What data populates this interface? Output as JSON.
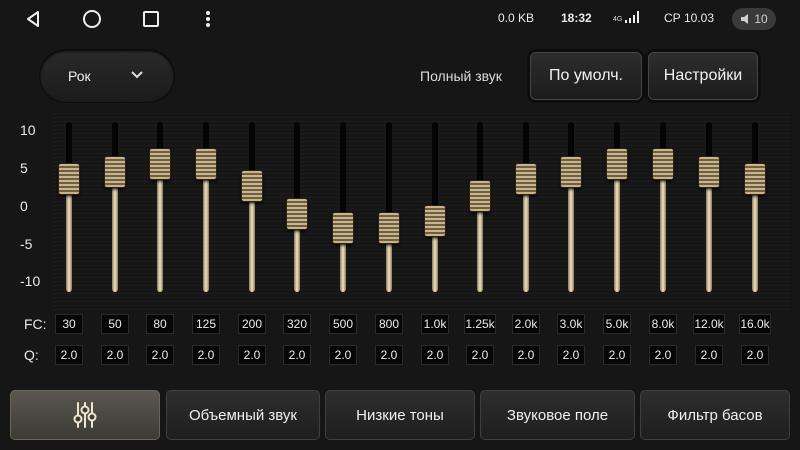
{
  "status": {
    "data_rate": "0.0 KB",
    "time": "18:32",
    "network": "4G",
    "date": "СР 10.03",
    "volume": "10"
  },
  "top": {
    "preset_value": "Рок",
    "full_sound_label": "Полный звук",
    "default_button": "По умолч.",
    "settings_button": "Настройки"
  },
  "scale": [
    "10",
    "5",
    "0",
    "-5",
    "-10"
  ],
  "fc_label": "FC:",
  "q_label": "Q:",
  "bands": [
    {
      "fc": "30",
      "q": "2.0",
      "gain": 4
    },
    {
      "fc": "50",
      "q": "2.0",
      "gain": 5
    },
    {
      "fc": "80",
      "q": "2.0",
      "gain": 6
    },
    {
      "fc": "125",
      "q": "2.0",
      "gain": 6
    },
    {
      "fc": "200",
      "q": "2.0",
      "gain": 3
    },
    {
      "fc": "320",
      "q": "2.0",
      "gain": -1
    },
    {
      "fc": "500",
      "q": "2.0",
      "gain": -3
    },
    {
      "fc": "800",
      "q": "2.0",
      "gain": -3
    },
    {
      "fc": "1.0k",
      "q": "2.0",
      "gain": -2
    },
    {
      "fc": "1.25k",
      "q": "2.0",
      "gain": 1.5
    },
    {
      "fc": "2.0k",
      "q": "2.0",
      "gain": 4
    },
    {
      "fc": "3.0k",
      "q": "2.0",
      "gain": 5
    },
    {
      "fc": "5.0k",
      "q": "2.0",
      "gain": 6
    },
    {
      "fc": "8.0k",
      "q": "2.0",
      "gain": 6
    },
    {
      "fc": "12.0k",
      "q": "2.0",
      "gain": 5
    },
    {
      "fc": "16.0k",
      "q": "2.0",
      "gain": 4
    }
  ],
  "bottom": {
    "eq_tab_icon": "equalizer-icon",
    "surround": "Объемный звук",
    "bass": "Низкие тоны",
    "sound_field": "Звуковое поле",
    "bass_filter": "Фильтр басов"
  },
  "colors": {
    "accent_gold": "#c9b58d",
    "background": "#161616"
  }
}
